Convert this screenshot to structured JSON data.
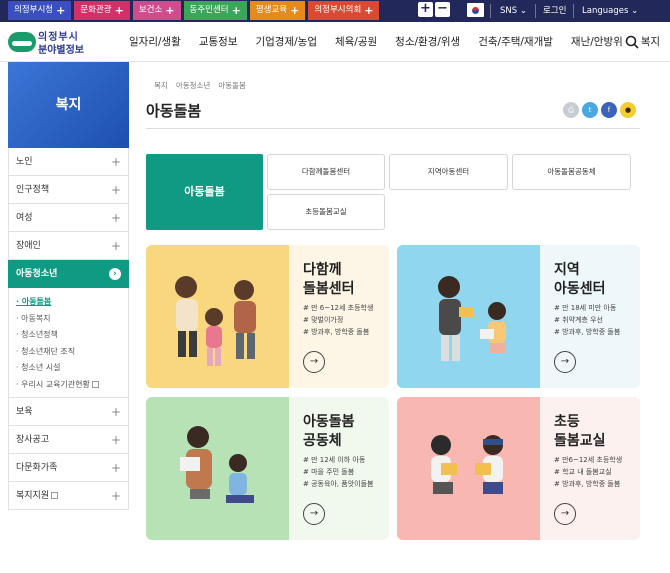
{
  "colors": {
    "topbar": "#23285a",
    "accent": "#0f9a83",
    "site_link_colors": [
      "#3c4fc2",
      "#d0316a",
      "#cf4d8e",
      "#3aa55b",
      "#e58a1f",
      "#d94a34"
    ]
  },
  "top_bar": {
    "site_links": [
      "의정부시청",
      "문화관광",
      "보건소",
      "동주민센터",
      "평생교육",
      "의정부시의회"
    ],
    "zoom_in": "+",
    "zoom_out": "−",
    "sns": "SNS",
    "login": "로그인",
    "languages": "Languages"
  },
  "header": {
    "logo_line1": "의정부시",
    "logo_line2": "분야별정보",
    "nav": [
      "일자리/생활",
      "교통정보",
      "기업경제/농업",
      "체육/공원",
      "청소/환경/위생",
      "건축/주택/재개발",
      "재난/안방위",
      "복지"
    ]
  },
  "sidebar": {
    "title": "복지",
    "items_top": [
      {
        "label": "노인",
        "sym": "+"
      },
      {
        "label": "인구정책",
        "sym": "+"
      },
      {
        "label": "여성",
        "sym": "+"
      },
      {
        "label": "장애인",
        "sym": "+"
      }
    ],
    "active": {
      "label": "아동청소년",
      "sym": "›"
    },
    "sub_items": [
      "아동돌봄",
      "아동복지",
      "청소년정책",
      "청소년재단 조직",
      "청소년 시설",
      "우리시 교육기관현황"
    ],
    "items_bottom": [
      {
        "label": "보육",
        "sym": "+"
      },
      {
        "label": "장사공고",
        "sym": "+"
      },
      {
        "label": "다문화가족",
        "sym": "+"
      },
      {
        "label": "복지지원",
        "sym": "+"
      }
    ]
  },
  "breadcrumb": [
    "복지",
    "아동청소년",
    "아동돌봄"
  ],
  "page_title": "아동돌봄",
  "tabs": {
    "main": "아동돌봄",
    "items": [
      "다함께돌봄센터",
      "지역아동센터",
      "아동돌봄공동체",
      "초등돌봄교실"
    ]
  },
  "cards": [
    {
      "title1": "다함께",
      "title2": "돌봄센터",
      "tags": [
        "# 만 6~12세 초등학생",
        "# 맞벌이가정",
        "# 방과후, 방학중 돌봄"
      ],
      "art_color": "#f9d77e",
      "bg": "#fdf6e6"
    },
    {
      "title1": "지역",
      "title2": "아동센터",
      "tags": [
        "# 만 18세 미만 아동",
        "# 취약계층 우선",
        "# 방과후, 방학중 돌봄"
      ],
      "art_color": "#8fd6ee",
      "bg": "#eef8fb"
    },
    {
      "title1": "아동돌봄",
      "title2": "공동체",
      "tags": [
        "# 만 12세 이하 아동",
        "# 마을 주민 돌봄",
        "# 공동육아, 품앗이돌봄"
      ],
      "art_color": "#b7e2b6",
      "bg": "#f1f9ef"
    },
    {
      "title1": "초등",
      "title2": "돌봄교실",
      "tags": [
        "# 만6~12세 초등학생",
        "# 학교 내 돌봄교실",
        "# 방과후, 방학중 돌봄"
      ],
      "art_color": "#f8b7b0",
      "bg": "#fdf1ef"
    }
  ],
  "card_arrow": "→"
}
